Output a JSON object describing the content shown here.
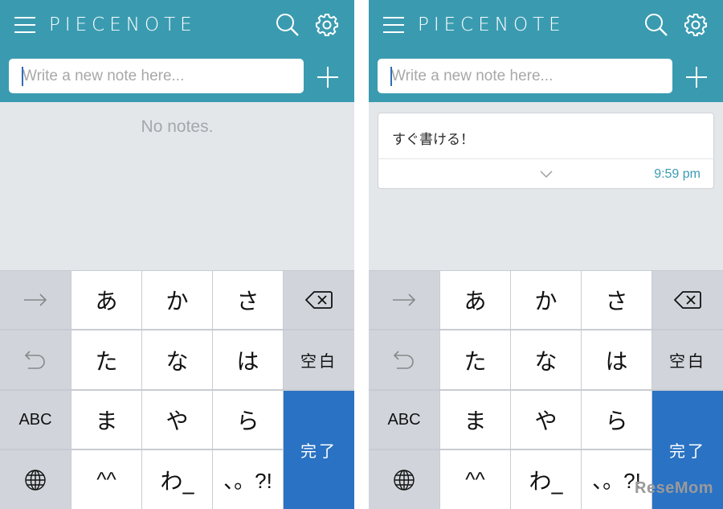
{
  "app": {
    "title": "PIECENOTE"
  },
  "composer": {
    "placeholder": "Write a new note here..."
  },
  "left_screen": {
    "empty_message": "No notes."
  },
  "right_screen": {
    "notes": [
      {
        "text": "すぐ書ける！",
        "time": "9:59 pm"
      }
    ]
  },
  "keyboard": {
    "rows": [
      [
        "あ",
        "か",
        "さ"
      ],
      [
        "た",
        "な",
        "は"
      ],
      [
        "ま",
        "や",
        "ら"
      ],
      [
        "^^",
        "わ_",
        "、。?!"
      ]
    ],
    "abc_label": "ABC",
    "space_label": "空白",
    "done_label": "完了"
  },
  "icons": {
    "menu": "hamburger-menu-icon",
    "search": "search-icon",
    "settings": "gear-icon",
    "add": "plus-icon",
    "next": "arrow-right-icon",
    "undo": "undo-icon",
    "delete": "backspace-icon",
    "globe": "globe-icon",
    "expand": "chevron-down-icon"
  },
  "colors": {
    "header": "#3a9bb0",
    "background": "#e4e7ea",
    "done_key": "#2a72c4",
    "time_text": "#3a9bb0"
  },
  "watermark": "ReseMom"
}
